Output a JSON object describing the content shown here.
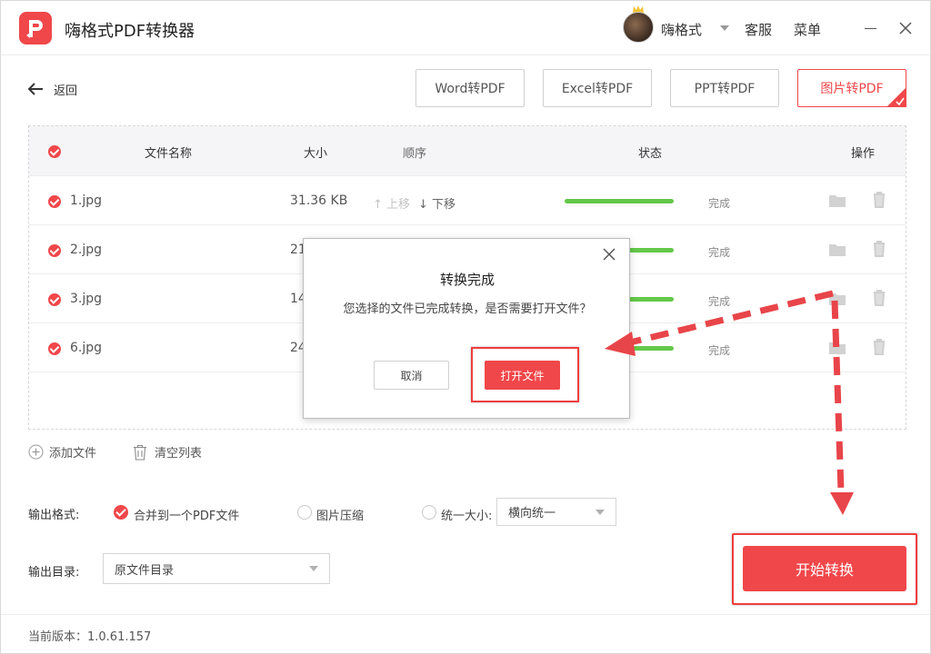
{
  "app": {
    "title": "嗨格式PDF转换器",
    "logo_icon": "pdf-logo-icon"
  },
  "header": {
    "user_name": "嗨格式",
    "service": "客服",
    "menu": "菜单"
  },
  "nav": {
    "back_label": "返回",
    "tabs": [
      {
        "label": "Word转PDF",
        "active": false
      },
      {
        "label": "Excel转PDF",
        "active": false
      },
      {
        "label": "PPT转PDF",
        "active": false
      },
      {
        "label": "图片转PDF",
        "active": true
      }
    ]
  },
  "table": {
    "columns": {
      "name": "文件名称",
      "size": "大小",
      "order": "顺序",
      "status": "状态",
      "actions": "操作"
    },
    "order_up": "↑ 上移",
    "order_down": "↓ 下移",
    "rows": [
      {
        "name": "1.jpg",
        "size": "31.36 KB",
        "status": "完成",
        "progress": 1.0
      },
      {
        "name": "2.jpg",
        "size": "21",
        "status": "完成",
        "progress": 1.0
      },
      {
        "name": "3.jpg",
        "size": "14",
        "status": "完成",
        "progress": 1.0
      },
      {
        "name": "6.jpg",
        "size": "24",
        "status": "完成",
        "progress": 1.0
      }
    ]
  },
  "actions": {
    "add_file": "添加文件",
    "clear_list": "清空列表"
  },
  "output": {
    "format_label": "输出格式:",
    "options": [
      {
        "label": "合并到一个PDF文件",
        "selected": true
      },
      {
        "label": "图片压缩",
        "selected": false
      },
      {
        "label": "统一大小:",
        "selected": false
      }
    ],
    "size_select": "横向统一",
    "dir_label": "输出目录:",
    "dir_select": "原文件目录"
  },
  "start_button": "开始转换",
  "footer": {
    "version": "当前版本：1.0.61.157"
  },
  "dialog": {
    "title": "转换完成",
    "message": "您选择的文件已完成转换，是否需要打开文件？",
    "cancel": "取消",
    "open": "打开文件"
  },
  "colors": {
    "accent": "#f0474a",
    "progress": "#64c84a"
  }
}
